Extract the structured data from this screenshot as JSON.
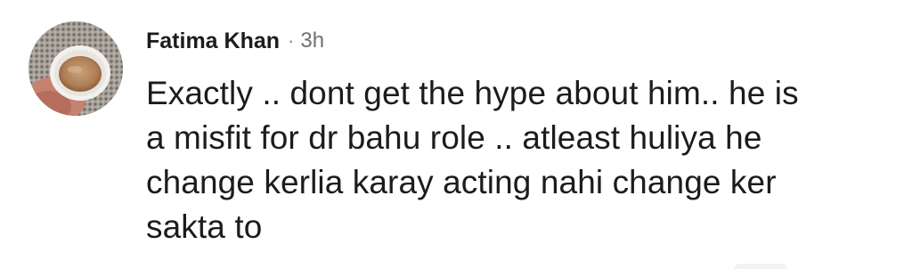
{
  "comment": {
    "author": "Fatima Khan",
    "separator": "·",
    "time": "3h",
    "lines": [
      "Exactly .. dont get the hype about him.. he is",
      "a misfit for dr bahu role .. atleast huliya he",
      "change kerlia karay acting nahi change ker",
      "sakta to"
    ]
  },
  "icons": {
    "avatar": "profile-photo-teacup"
  },
  "colors": {
    "text": "#1c1c1c",
    "muted": "#6f6f6f",
    "background": "#ffffff"
  }
}
